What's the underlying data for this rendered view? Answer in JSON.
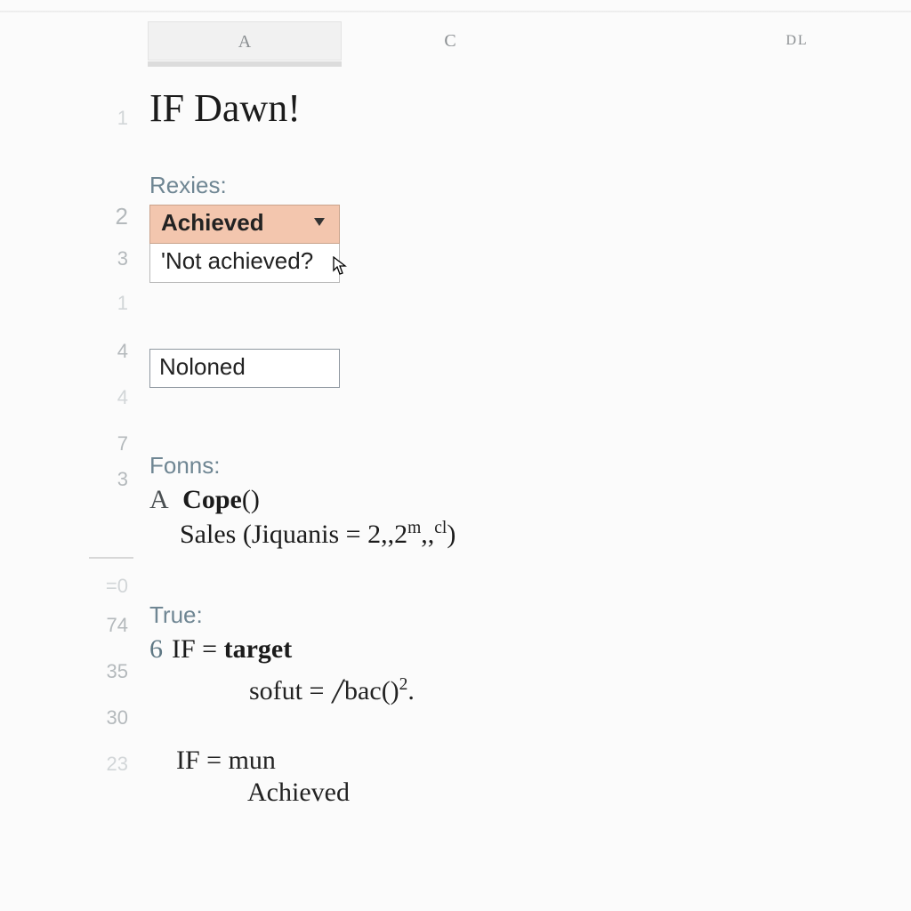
{
  "columns": {
    "a": "A",
    "c": "C",
    "dl": "DL"
  },
  "gutter": {
    "r1": "1",
    "r2": "2",
    "r3": "3",
    "r1b": "1",
    "r4": "4",
    "r4b": "4",
    "r7": "7",
    "r3b": "3",
    "eq0": "=0",
    "r74": "74",
    "r35": "35",
    "r30": "30",
    "r23": "23"
  },
  "title": "IF Dawn!",
  "rexies": {
    "label": "Rexies:",
    "selected": "Achieved",
    "option": "'Not achieved?"
  },
  "noloned": "Noloned",
  "fonns": {
    "label": "Fonns:",
    "lead": "A",
    "func": "Cope",
    "parens": "()",
    "line2_a": "Sales (Jiquanis = 2,,2",
    "line2_sup1": "m",
    "line2_mid": ",,",
    "line2_sup2": "cl",
    "line2_end": ")"
  },
  "trueblk": {
    "label": "True:",
    "l1_num": "6",
    "l1_a": "IF = ",
    "l1_b": "target",
    "l2_a": "sofut  = ",
    "l2_b": "bac",
    "l2_parens": "()",
    "l2_sup": "2",
    "l2_dot": ".",
    "l3": "IF = mun",
    "l4": "Achieved"
  }
}
